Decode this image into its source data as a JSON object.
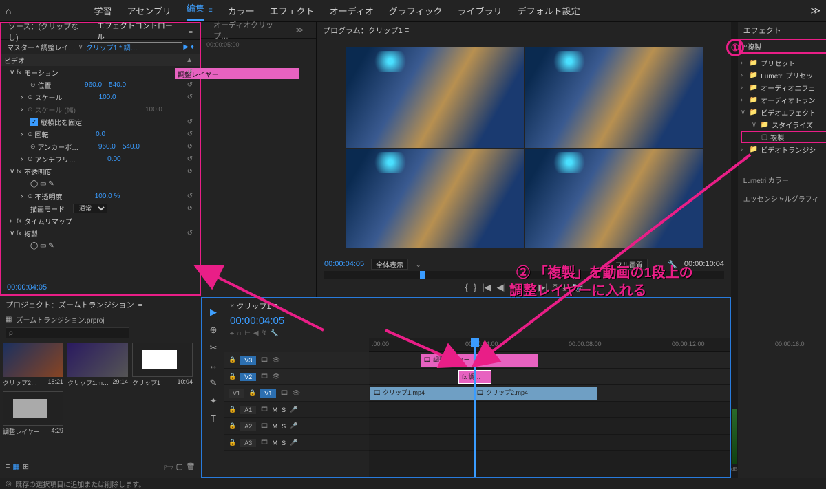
{
  "nav": {
    "home": "⌂",
    "tabs": [
      "学習",
      "アセンブリ",
      "編集",
      "カラー",
      "エフェクト",
      "オーディオ",
      "グラフィック",
      "ライブラリ",
      "デフォルト設定"
    ],
    "activeIndex": 2,
    "more": "≫"
  },
  "effectControls": {
    "tab_source": "ソース：(クリップなし)",
    "tab_ec": "エフェクトコントロール",
    "master_label": "マスター * 調整レイ…",
    "clip_label": "クリップ1 * 調…",
    "video_header": "ビデオ",
    "adjustment_bar": "調整レイヤー",
    "motion": "モーション",
    "position": "位置",
    "pos_x": "960.0",
    "pos_y": "540.0",
    "scale": "スケール",
    "scale_val": "100.0",
    "scale_w": "スケール (幅)",
    "scale_w_val": "100.0",
    "lock_aspect": "縦横比を固定",
    "rotation": "回転",
    "rotation_val": "0.0",
    "anchor": "アンカーポ…",
    "anchor_x": "960.0",
    "anchor_y": "540.0",
    "antiflicker": "アンチフリ…",
    "antiflicker_val": "0.00",
    "opacity": "不透明度",
    "opacity_val": "100.0 %",
    "blend_mode_label": "描画モード",
    "blend_mode_val": "通常",
    "timeremap": "タイムリマップ",
    "duplicate": "複製",
    "timecode": "00:00:04:05",
    "ruler_label": "00:00:05:00"
  },
  "audioClip": {
    "tab": "オーディオクリップ…"
  },
  "program": {
    "tab": "プログラム：クリップ1",
    "timecode": "00:00:04:05",
    "fit": "全体表示",
    "quality": "フル画質",
    "duration": "00:00:10:04"
  },
  "project": {
    "tab": "プロジェクト：ズームトランジション",
    "filename": "ズームトランジション.prproj",
    "search_placeholder": "ρ",
    "items": [
      {
        "name": "クリップ2…",
        "dur": "18:21"
      },
      {
        "name": "クリップ1.m…",
        "dur": "29:14"
      },
      {
        "name": "クリップ1",
        "dur": "10:04"
      },
      {
        "name": "調整レイヤー",
        "dur": "4:29"
      }
    ]
  },
  "timeline": {
    "tab": "クリップ1",
    "timecode": "00:00:04:05",
    "ruler": [
      ":00:00",
      "00:00:04:00",
      "00:00:08:00",
      "00:00:12:00",
      "00:00:16:0"
    ],
    "tracks_v": [
      "V3",
      "V2",
      "V1"
    ],
    "tracks_a": [
      "A1",
      "A2",
      "A3"
    ],
    "clips": {
      "adj_layer_v3": "調整レイヤー",
      "adj_v2": "調…",
      "clip1": "クリップ1.mp4",
      "clip2": "クリップ2.mp4"
    },
    "v1_label": "V1"
  },
  "tools": [
    "▶",
    "⊕",
    "✂",
    "↔",
    "✎",
    "✦",
    "T"
  ],
  "effects": {
    "tab": "エフェクト",
    "search": "複製",
    "nodes": [
      {
        "label": "プリセット",
        "indent": 0,
        "open": false
      },
      {
        "label": "Lumetri プリセッ",
        "indent": 0,
        "open": false
      },
      {
        "label": "オーディオエフェ",
        "indent": 0,
        "open": false
      },
      {
        "label": "オーディオトラン",
        "indent": 0,
        "open": false
      },
      {
        "label": "ビデオエフェクト",
        "indent": 0,
        "open": true
      },
      {
        "label": "スタイライズ",
        "indent": 1,
        "open": true
      },
      {
        "label": "複製",
        "indent": 2,
        "selected": true
      },
      {
        "label": "ビデオトランジシ",
        "indent": 0,
        "open": false
      }
    ],
    "lumetri": "Lumetri カラー",
    "essential": "エッセンシャルグラフィ"
  },
  "annotations": {
    "circ1": "①",
    "circ2": "②",
    "line1": "「複製」を動画の1段上の",
    "line2": "調整レイヤーに入れる"
  },
  "status": "既存の選択項目に追加または削除します。",
  "meter_db": "dB"
}
